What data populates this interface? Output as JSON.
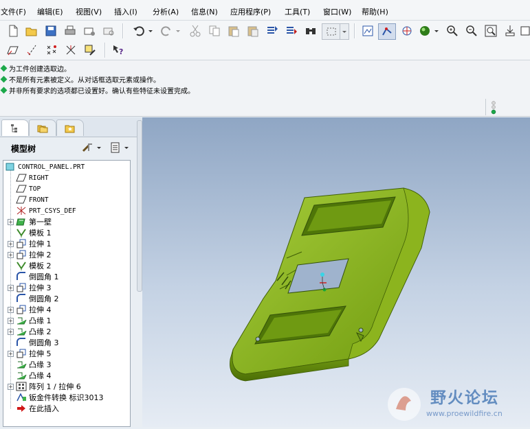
{
  "menu": [
    "文件(F)",
    "编辑(E)",
    "视图(V)",
    "插入(I)",
    "分析(A)",
    "信息(N)",
    "应用程序(P)",
    "工具(T)",
    "窗口(W)",
    "帮助(H)"
  ],
  "messages": [
    "为工件创建选取边。",
    "不是所有元素被定义。从对话框选取元素或操作。",
    "并非所有要求的选项都已设置好。确认有些特征未设置完成。"
  ],
  "panel": {
    "title": "模型树"
  },
  "tree": [
    {
      "label": "CONTROL_PANEL.PRT",
      "icon": "part-icon",
      "expand": false,
      "mono": true
    },
    {
      "label": "RIGHT",
      "icon": "datum-plane-icon",
      "expand": false,
      "mono": true
    },
    {
      "label": "TOP",
      "icon": "datum-plane-icon",
      "expand": false,
      "mono": true
    },
    {
      "label": "FRONT",
      "icon": "datum-plane-icon",
      "expand": false,
      "mono": true
    },
    {
      "label": "PRT_CSYS_DEF",
      "icon": "csys-icon",
      "expand": false,
      "mono": true
    },
    {
      "label": "第一壁",
      "icon": "first-wall-icon",
      "expand": true,
      "mono": false
    },
    {
      "label": "模板 1",
      "icon": "template-icon",
      "expand": false,
      "mono": false
    },
    {
      "label": "拉伸 1",
      "icon": "extrude-icon",
      "expand": true,
      "mono": false
    },
    {
      "label": "拉伸 2",
      "icon": "extrude-icon",
      "expand": true,
      "mono": false
    },
    {
      "label": "模板 2",
      "icon": "template-icon",
      "expand": false,
      "mono": false
    },
    {
      "label": "倒圆角 1",
      "icon": "round-icon",
      "expand": false,
      "mono": false
    },
    {
      "label": "拉伸 3",
      "icon": "extrude-icon",
      "expand": true,
      "mono": false
    },
    {
      "label": "倒圆角 2",
      "icon": "round-icon",
      "expand": false,
      "mono": false
    },
    {
      "label": "拉伸 4",
      "icon": "extrude-icon",
      "expand": true,
      "mono": false
    },
    {
      "label": "凸缘 1",
      "icon": "flange-icon",
      "expand": true,
      "mono": false
    },
    {
      "label": "凸缘 2",
      "icon": "flange-icon",
      "expand": true,
      "mono": false
    },
    {
      "label": "倒圆角 3",
      "icon": "round-icon",
      "expand": false,
      "mono": false
    },
    {
      "label": "拉伸 5",
      "icon": "extrude-icon",
      "expand": true,
      "mono": false
    },
    {
      "label": "凸缘 3",
      "icon": "flange-icon",
      "expand": false,
      "mono": false
    },
    {
      "label": "凸缘 4",
      "icon": "flange-icon",
      "expand": false,
      "mono": false
    },
    {
      "label": "阵列 1 / 拉伸 6",
      "icon": "pattern-icon",
      "expand": true,
      "mono": false
    },
    {
      "label": "钣金件转换 标识3013",
      "icon": "conversion-icon",
      "expand": false,
      "mono": false
    },
    {
      "label": "在此插入",
      "icon": "insert-here-icon",
      "expand": false,
      "mono": false
    }
  ],
  "watermark": {
    "name": "野火论坛",
    "url": "www.proewildfire.cn"
  },
  "colors": {
    "model": "#7aa814",
    "accent": "#1ca84a",
    "insert_arrow": "#d01818"
  }
}
